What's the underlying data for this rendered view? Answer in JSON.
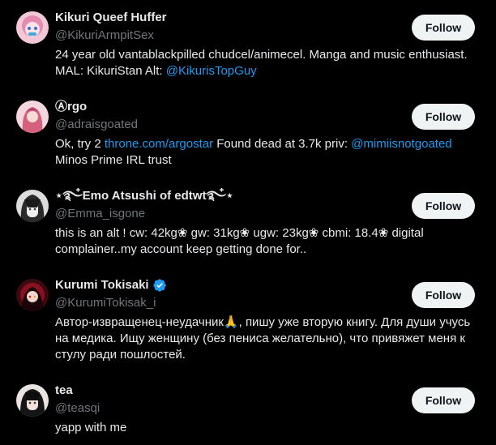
{
  "accounts": [
    {
      "name": "Kikuri Queef Huffer",
      "handle": "@KikuriArmpitSex",
      "bio_parts": [
        "24 year old vantablackpilled chudcel/animecel. Manga and music enthusiast. MAL: KikuriStan Alt: ",
        "@KikurisTopGuy"
      ],
      "follow_label": "Follow"
    },
    {
      "name": "Ⓐrgo",
      "handle": "@adraisgoated",
      "bio_parts": [
        "Ok, try 2 ",
        "throne.com/argostar",
        " Found dead at 3.7k priv: ",
        "@mimiisnotgoated",
        " Minos Prime IRL trust"
      ],
      "follow_label": "Follow"
    },
    {
      "name": "⋆࿐໋Emo Atsushi of edtwt࿐໋⋆",
      "handle": "@Emma_isgone",
      "bio": "this is an alt ! cw: 42kg❀ gw: 31kg❀ ugw: 23kg❀ cbmi: 18.4❀ digital complainer..my account keep getting done for..",
      "follow_label": "Follow"
    },
    {
      "name": "Kurumi Tokisaki",
      "handle": "@KurumiTokisak_i",
      "bio": "Автор-извращенец-неудачник🙏, пишу уже вторую книгу. Для души учусь на медика. Ищу женщину (без пениса желательно), что привяжет меня к стулу ради пошлостей.",
      "follow_label": "Follow",
      "verified": true
    },
    {
      "name": "tea",
      "handle": "@teasqi",
      "bio": "yapp with me",
      "follow_label": "Follow"
    }
  ],
  "colors": {
    "background": "#000000",
    "primary_text": "#e7e9ea",
    "secondary_text": "#71767b",
    "link": "#1d9bf0",
    "button_bg": "#eff3f4",
    "button_text": "#0f1419"
  }
}
